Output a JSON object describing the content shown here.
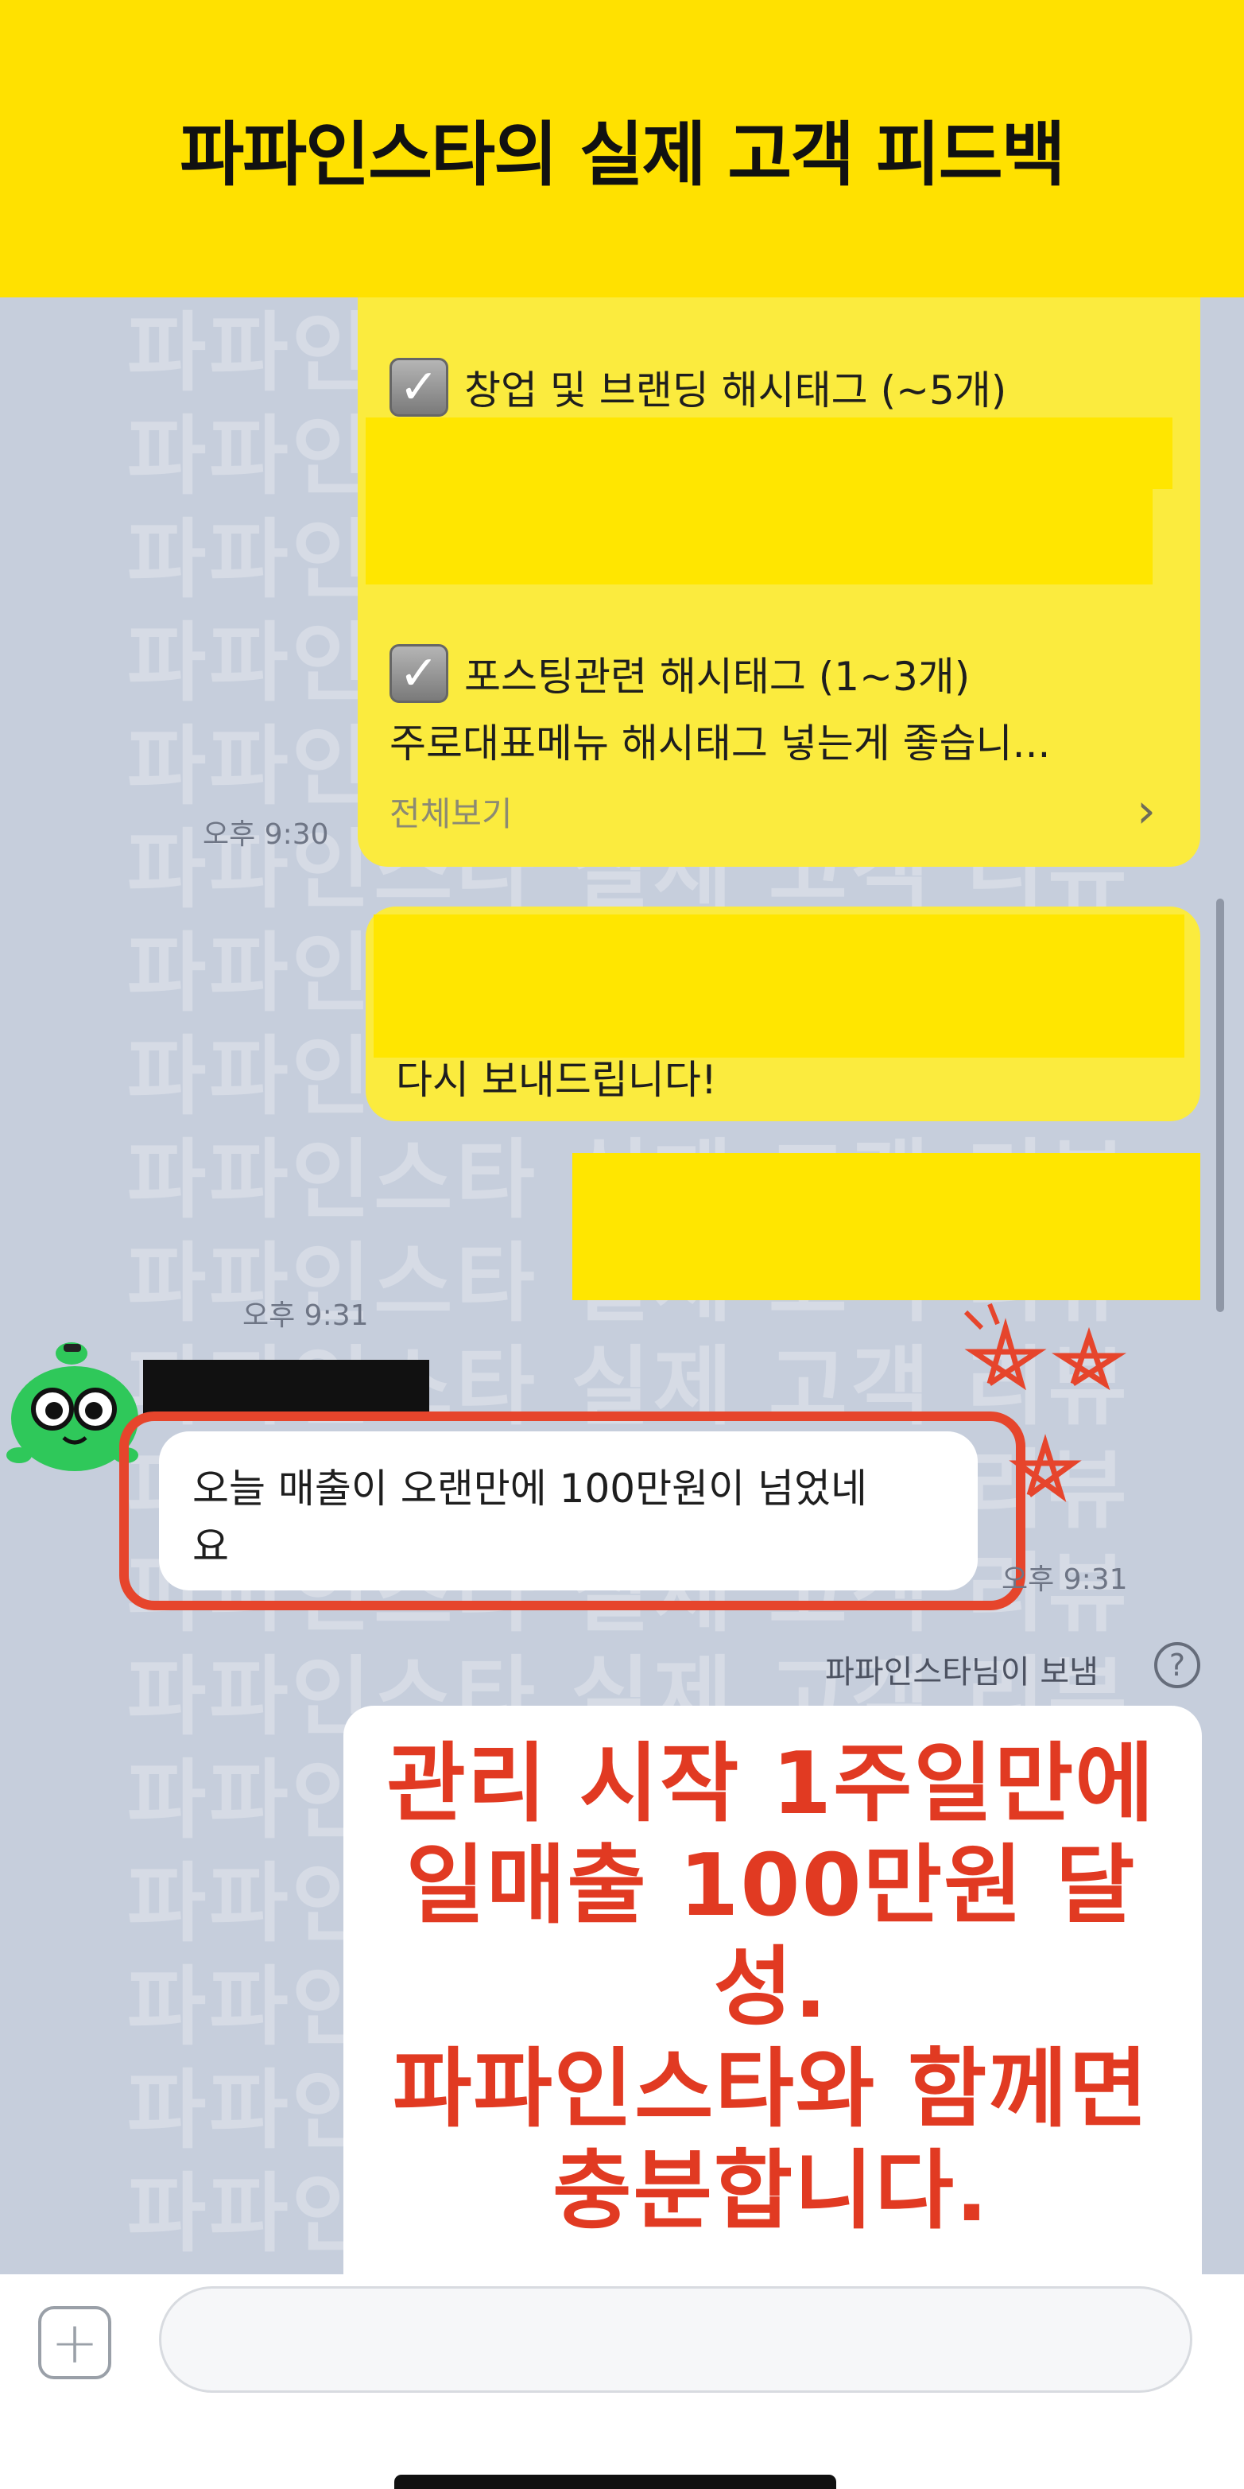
{
  "banner": {
    "title": "파파인스타의 실제 고객 피드백"
  },
  "watermark": {
    "text": "파파인스타 실제 고객 리뷰"
  },
  "messages": {
    "hashtag_message": {
      "line1": "창업 및 브랜딩 해시태그 (~5개)",
      "line2": "포스팅관련 해시태그 (1~3개)",
      "line3": "주로대표메뉴 해시태그 넣는게 좋습니...",
      "view_all": "전체보기",
      "time": "오후 9:30"
    },
    "resend_message": {
      "text": "다시 보내드립니다!"
    },
    "resend_time": "오후 9:31",
    "customer_message": {
      "text_line1": "오늘 매출이 오랜만에 100만원이 넘었네",
      "text_line2": "요",
      "time": "오후 9:31"
    },
    "system_note": "파파인스타님이 보냄",
    "promo": {
      "line1": "관리 시작 1주일만에",
      "line2": "일매출 100만원 달성.",
      "line3": "파파인스타와 함께면",
      "line4": "충분합니다."
    }
  },
  "input": {
    "placeholder": ""
  },
  "colors": {
    "banner": "#ffe100",
    "bubble_yellow": "#fbeb3e",
    "highlight": "#e6452c",
    "promo_text": "#e13a22"
  }
}
